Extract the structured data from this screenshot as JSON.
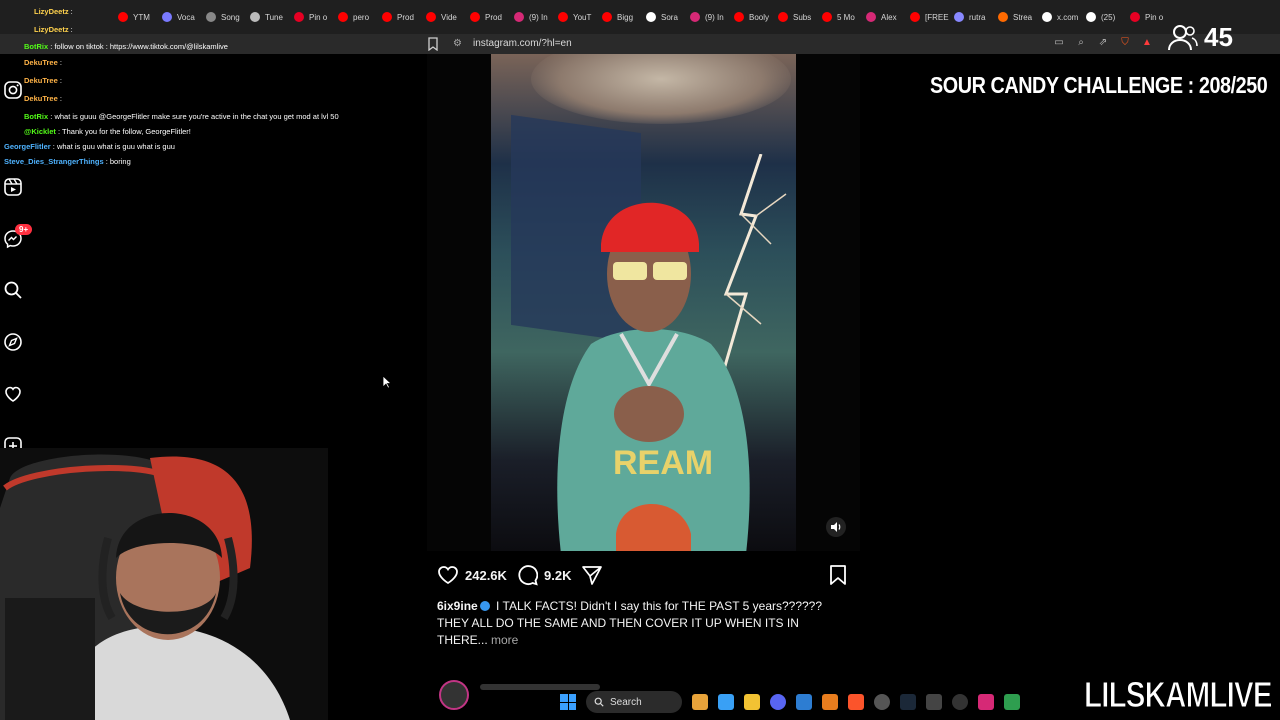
{
  "browser": {
    "tabs": [
      {
        "label": "YTM",
        "color": "#ff0000"
      },
      {
        "label": "Voca",
        "color": "#7a7aff"
      },
      {
        "label": "Song",
        "color": "#888888"
      },
      {
        "label": "Tune",
        "color": "#bbbbbb"
      },
      {
        "label": "Pin o",
        "color": "#e60023"
      },
      {
        "label": "pero",
        "color": "#ff0000"
      },
      {
        "label": "Prod",
        "color": "#ff0000"
      },
      {
        "label": "Vide",
        "color": "#ff0000"
      },
      {
        "label": "Prod",
        "color": "#ff0000"
      },
      {
        "label": "(9) In",
        "color": "#d62976"
      },
      {
        "label": "YouT",
        "color": "#ff0000"
      },
      {
        "label": "Bigg",
        "color": "#ff0000"
      },
      {
        "label": "Sora",
        "color": "#ffffff"
      },
      {
        "label": "(9) In",
        "color": "#d62976"
      },
      {
        "label": "Booly",
        "color": "#ff0000"
      },
      {
        "label": "Subs",
        "color": "#ff0000"
      },
      {
        "label": "5 Mo",
        "color": "#ff0000"
      },
      {
        "label": "Alex",
        "color": "#d62976"
      },
      {
        "label": "[FREE",
        "color": "#ff0000"
      },
      {
        "label": "rutra",
        "color": "#8888ff"
      },
      {
        "label": "Strea",
        "color": "#ff6a00"
      },
      {
        "label": "x.com",
        "color": "#ffffff"
      },
      {
        "label": "(25)",
        "color": "#ffffff"
      },
      {
        "label": "Pin o",
        "color": "#e60023"
      }
    ],
    "url": "instagram.com/?hl=en",
    "viewer_count": "45"
  },
  "chat": [
    {
      "user": "LizyDeetz",
      "message": "",
      "color": "#ffd24d"
    },
    {
      "user": "LizyDeetz",
      "message": "",
      "color": "#ffd24d"
    },
    {
      "user": "BotRix",
      "message": "follow on tiktok : https://www.tiktok.com/@lilskamlive",
      "color": "#53fc18"
    },
    {
      "user": "DekuTree",
      "message": "",
      "color": "#ffb347"
    },
    {
      "user": "DekuTree",
      "message": "",
      "color": "#ffb347"
    },
    {
      "user": "DekuTree",
      "message": "",
      "color": "#ffb347"
    },
    {
      "user": "BotRix",
      "message": "what is guuu @GeorgeFlitler make sure you're active in the chat you get mod at lvl 50",
      "color": "#53fc18"
    },
    {
      "user": "@Kicklet",
      "message": "Thank you for the follow, GeorgeFlitler!",
      "color": "#53fc18"
    },
    {
      "user": "GeorgeFlitler",
      "message": "what is guu what is guu what is guu",
      "color": "#4fb3ff"
    },
    {
      "user": "Steve_Dies_StrangerThings",
      "message": "boring",
      "color": "#4fb3ff"
    }
  ],
  "post": {
    "likes": "242.6K",
    "comments": "9.2K",
    "author": "6ix9ine",
    "caption_line1": "I TALK FACTS! Didn't I say this for THE PAST 5 years??????",
    "caption_line2": "THEY ALL DO THE SAME AND THEN COVER IT UP WHEN ITS IN",
    "caption_line3": "THERE...",
    "more_label": "more"
  },
  "sidebar": {
    "notification_badge": "9+"
  },
  "overlay": {
    "challenge": "SOUR CANDY CHALLENGE : 208/250",
    "brand": "LILSKAMLIVE"
  },
  "taskbar": {
    "search_label": "Search"
  },
  "colors": {
    "instagram_badge": "#ff3040",
    "verified": "#3797f0",
    "chat_bot": "#53fc18"
  }
}
